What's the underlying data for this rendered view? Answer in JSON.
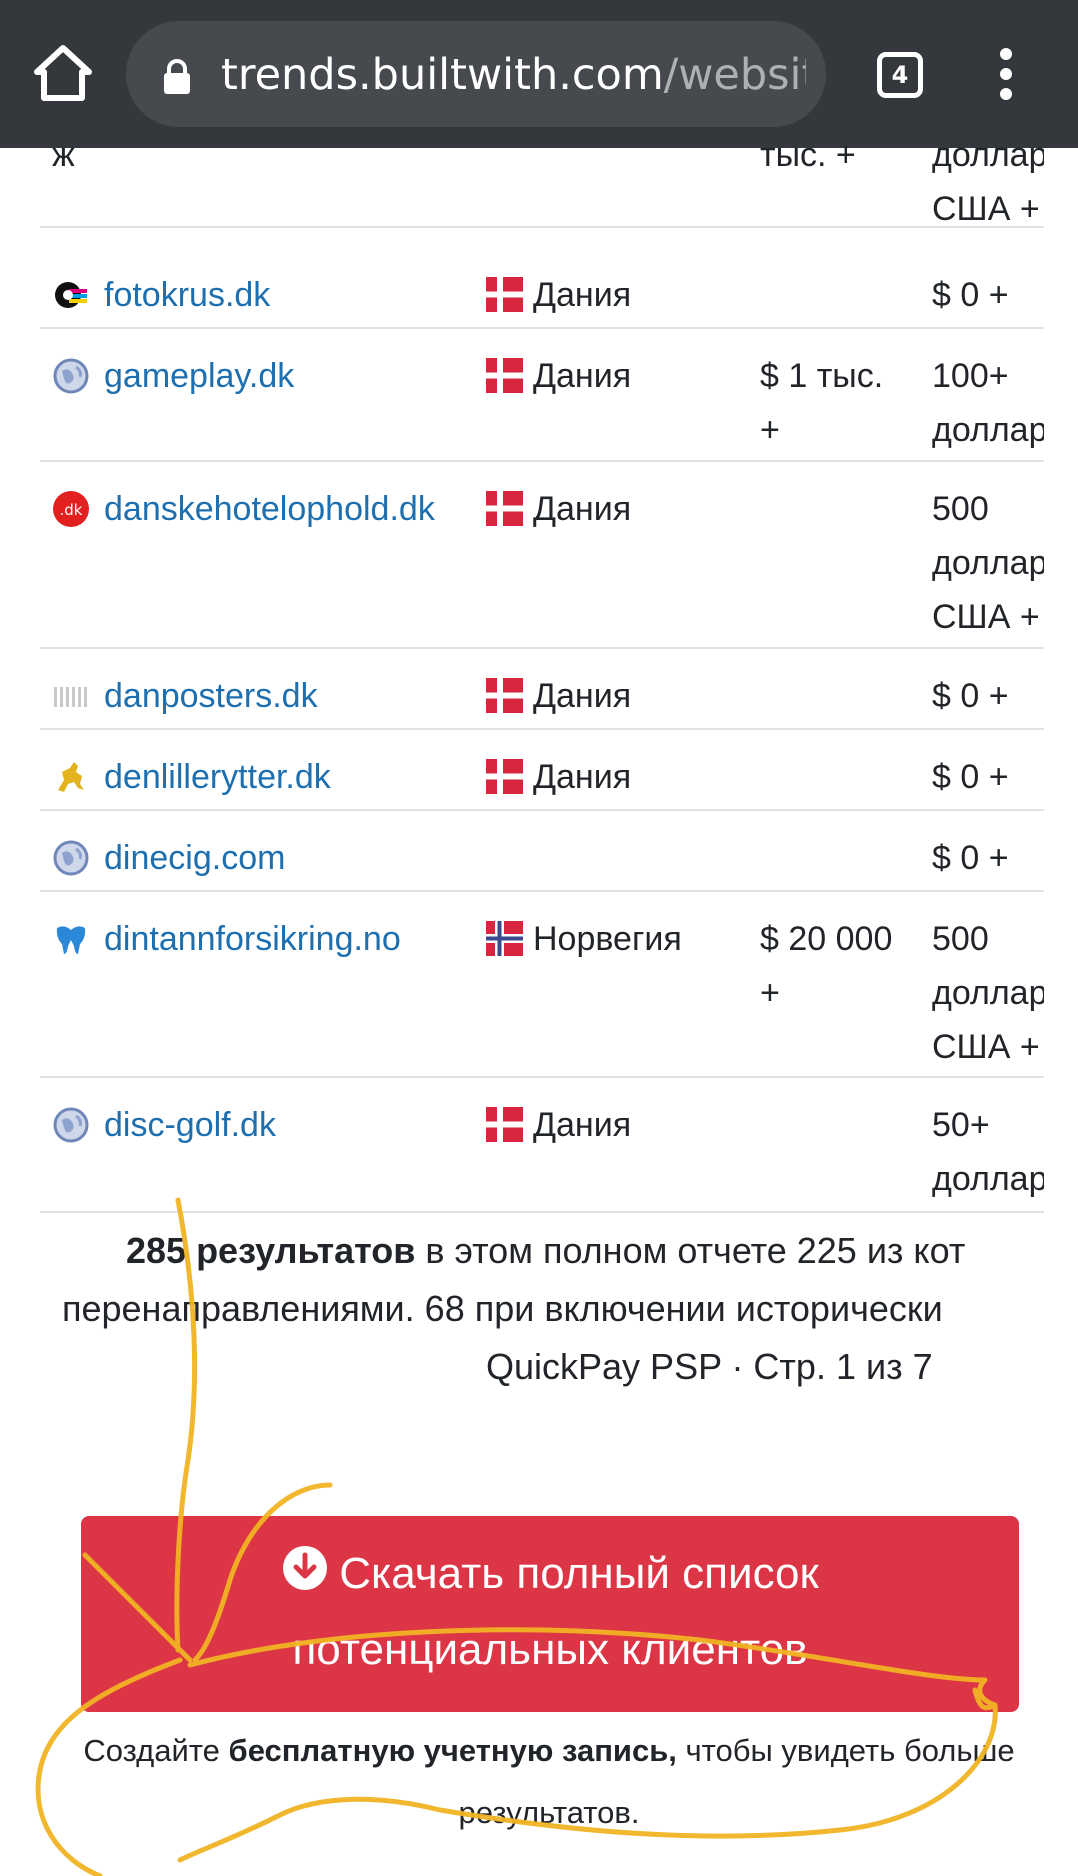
{
  "browser": {
    "url_host": "trends.builtwith.com",
    "url_path": "/website",
    "tab_count": "4"
  },
  "table": {
    "partial_row": {
      "site_tail": "ж",
      "sales": "тыс. +",
      "spend": "доллар\nСША +"
    },
    "rows": [
      {
        "site": "fotokrus.dk",
        "favicon": "fotokrus-logo-icon",
        "country": "Дания",
        "flag": "denmark-flag-icon",
        "sales": "",
        "spend": "$ 0 +"
      },
      {
        "site": "gameplay.dk",
        "favicon": "globe-icon",
        "country": "Дания",
        "flag": "denmark-flag-icon",
        "sales": "$ 1 тыс.\n+",
        "spend": "100+\nдоллар"
      },
      {
        "site": "danskehotelophold.dk",
        "favicon": "dk-red-circle-icon",
        "country": "Дания",
        "flag": "denmark-flag-icon",
        "sales": "",
        "spend": "500\nдоллар\nСША +"
      },
      {
        "site": "danposters.dk",
        "favicon": "danposters-logo-icon",
        "country": "Дания",
        "flag": "denmark-flag-icon",
        "sales": "",
        "spend": "$ 0 +"
      },
      {
        "site": "denlillerytter.dk",
        "favicon": "rider-logo-icon",
        "country": "Дания",
        "flag": "denmark-flag-icon",
        "sales": "",
        "spend": "$ 0 +"
      },
      {
        "site": "dinecig.com",
        "favicon": "globe-icon",
        "country": "",
        "flag": "",
        "sales": "",
        "spend": "$ 0 +"
      },
      {
        "site": "dintannforsikring.no",
        "favicon": "tooth-logo-icon",
        "country": "Норвегия",
        "flag": "norway-flag-icon",
        "sales": "$ 20 000\n+",
        "spend": "500\nдоллар\nСША +"
      },
      {
        "site": "disc-golf.dk",
        "favicon": "globe-icon",
        "country": "Дания",
        "flag": "denmark-flag-icon",
        "sales": "",
        "spend": "50+\nдоллар"
      }
    ]
  },
  "summary": {
    "count_bold": "285 результатов",
    "line1_rest": " в этом полном отчете 225 из кот",
    "line2": "перенаправлениями. 68 при включении исторически",
    "line3": "QuickPay PSP · Стр. 1 из 7"
  },
  "download_button": {
    "line1": "Скачать полный список",
    "line2": "потенциальных клиентов"
  },
  "signup": {
    "prefix": "Создайте ",
    "bold": "бесплатную учетную запись,",
    "suffix": " чтобы увидеть больше результатов."
  },
  "colors": {
    "topbar": "#34383c",
    "urlbox": "#46494d",
    "link": "#1d6fb0",
    "button": "#dc3545",
    "scribble": "#f0b323"
  }
}
